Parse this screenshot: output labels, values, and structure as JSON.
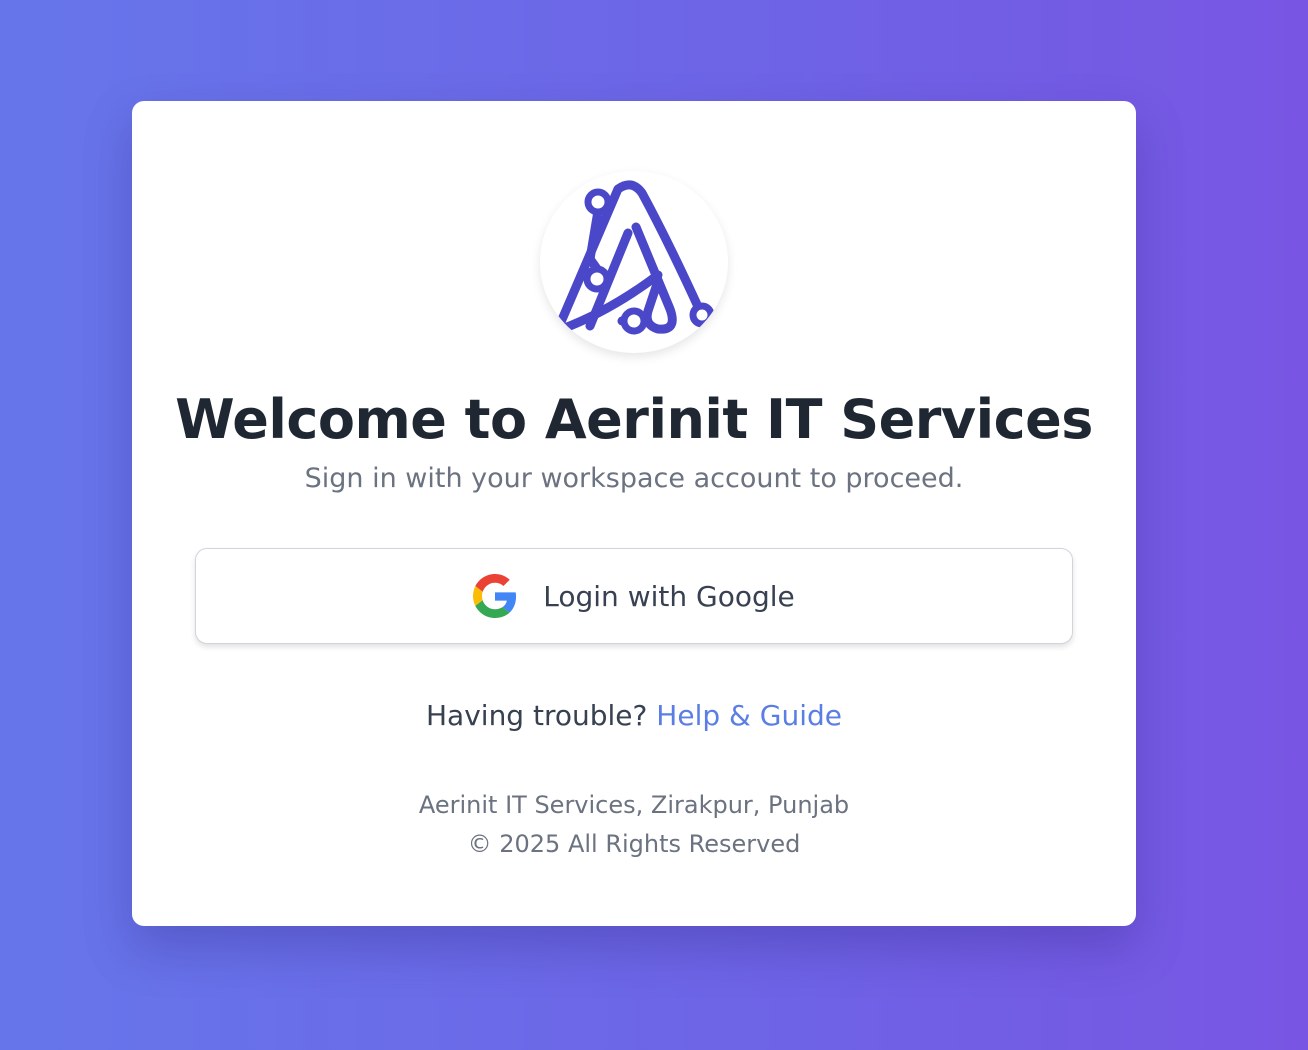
{
  "brand": {
    "logo_icon": "aerinit-circuit-a-logo",
    "logo_color": "#4a48c9"
  },
  "header": {
    "title": "Welcome to Aerinit IT Services",
    "subtitle": "Sign in with your workspace account to proceed."
  },
  "login": {
    "google_icon": "google-g-icon",
    "google_label": "Login with Google"
  },
  "help": {
    "prompt": "Having trouble?",
    "link_label": "Help & Guide",
    "link_color": "#5b7ee5"
  },
  "footer": {
    "address": "Aerinit IT Services, Zirakpur, Punjab",
    "copyright": "© 2025 All Rights Reserved"
  },
  "colors": {
    "background_start": "#6676ea",
    "background_end": "#7856e3",
    "title": "#1f2733",
    "muted_text": "#6b7280"
  }
}
